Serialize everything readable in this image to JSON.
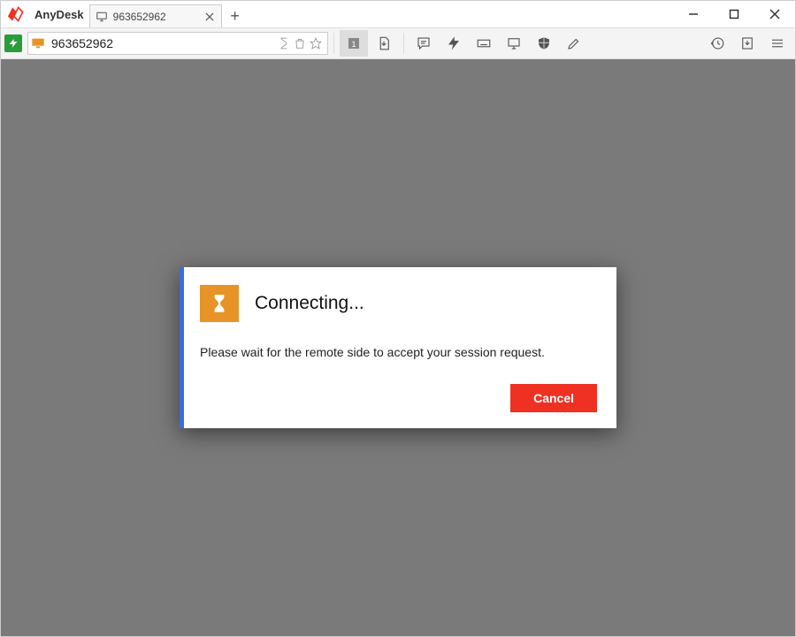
{
  "app": {
    "name": "AnyDesk"
  },
  "tab": {
    "label": "963652962"
  },
  "address": {
    "value": "963652962"
  },
  "toolbar": {
    "display_number": "1"
  },
  "dialog": {
    "title": "Connecting...",
    "message": "Please wait for the remote side to accept your session request.",
    "cancel": "Cancel"
  }
}
